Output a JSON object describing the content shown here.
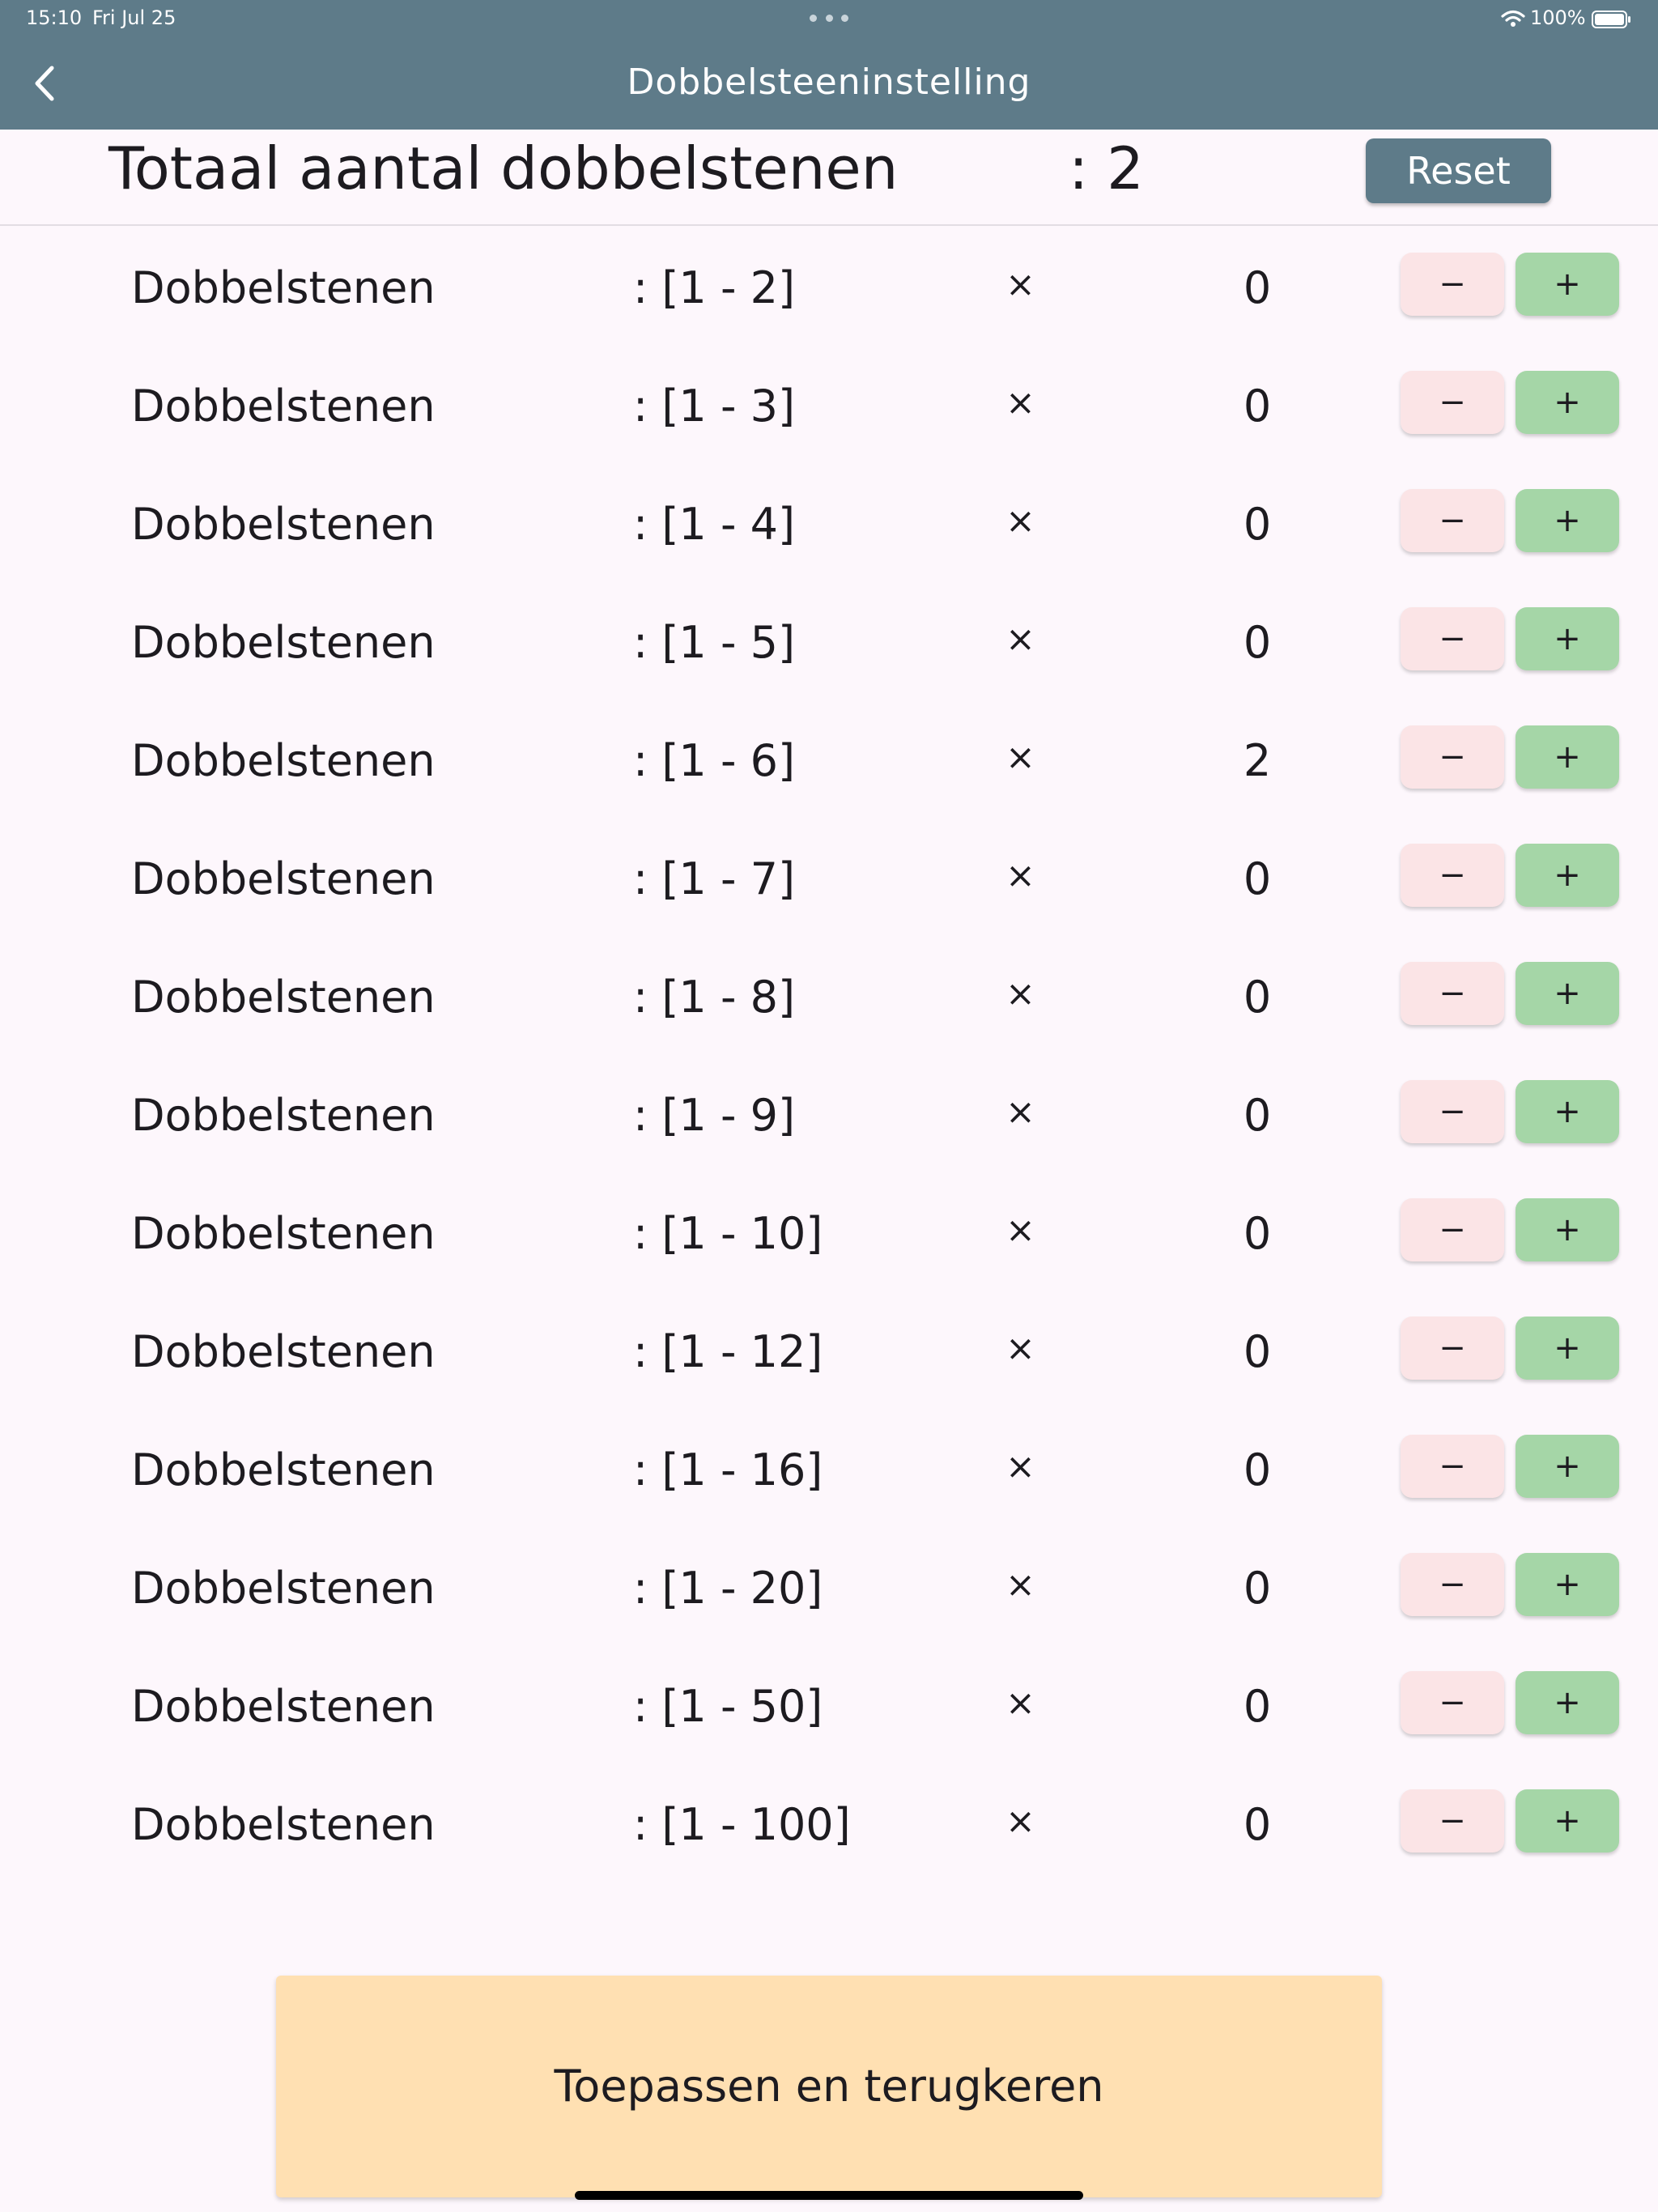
{
  "status_bar": {
    "time": "15:10",
    "date": "Fri Jul 25",
    "battery": "100%"
  },
  "appbar": {
    "title": "Dobbelsteeninstelling",
    "color": "#5e7b89"
  },
  "total": {
    "label": "Totaal aantal dobbelstenen",
    "value": ": 2"
  },
  "reset_label": "Reset",
  "dice": [
    {
      "label": "Dobbelstenen",
      "range": ": [1 - 2]",
      "times": "×",
      "count": "0",
      "minus": "−",
      "plus": "+"
    },
    {
      "label": "Dobbelstenen",
      "range": ": [1 - 3]",
      "times": "×",
      "count": "0",
      "minus": "−",
      "plus": "+"
    },
    {
      "label": "Dobbelstenen",
      "range": ": [1 - 4]",
      "times": "×",
      "count": "0",
      "minus": "−",
      "plus": "+"
    },
    {
      "label": "Dobbelstenen",
      "range": ": [1 - 5]",
      "times": "×",
      "count": "0",
      "minus": "−",
      "plus": "+"
    },
    {
      "label": "Dobbelstenen",
      "range": ": [1 - 6]",
      "times": "×",
      "count": "2",
      "minus": "−",
      "plus": "+"
    },
    {
      "label": "Dobbelstenen",
      "range": ": [1 - 7]",
      "times": "×",
      "count": "0",
      "minus": "−",
      "plus": "+"
    },
    {
      "label": "Dobbelstenen",
      "range": ": [1 - 8]",
      "times": "×",
      "count": "0",
      "minus": "−",
      "plus": "+"
    },
    {
      "label": "Dobbelstenen",
      "range": ": [1 - 9]",
      "times": "×",
      "count": "0",
      "minus": "−",
      "plus": "+"
    },
    {
      "label": "Dobbelstenen",
      "range": ": [1 - 10]",
      "times": "×",
      "count": "0",
      "minus": "−",
      "plus": "+"
    },
    {
      "label": "Dobbelstenen",
      "range": ": [1 - 12]",
      "times": "×",
      "count": "0",
      "minus": "−",
      "plus": "+"
    },
    {
      "label": "Dobbelstenen",
      "range": ": [1 - 16]",
      "times": "×",
      "count": "0",
      "minus": "−",
      "plus": "+"
    },
    {
      "label": "Dobbelstenen",
      "range": ": [1 - 20]",
      "times": "×",
      "count": "0",
      "minus": "−",
      "plus": "+"
    },
    {
      "label": "Dobbelstenen",
      "range": ": [1 - 50]",
      "times": "×",
      "count": "0",
      "minus": "−",
      "plus": "+"
    },
    {
      "label": "Dobbelstenen",
      "range": ": [1 - 100]",
      "times": "×",
      "count": "0",
      "minus": "−",
      "plus": "+"
    }
  ],
  "apply_label": "Toepassen en terugkeren",
  "colors": {
    "background": "#fdf7fc",
    "minus_button": "#fbe4e6",
    "plus_button": "#a5d6a7",
    "apply_button": "#ffe0b2"
  }
}
